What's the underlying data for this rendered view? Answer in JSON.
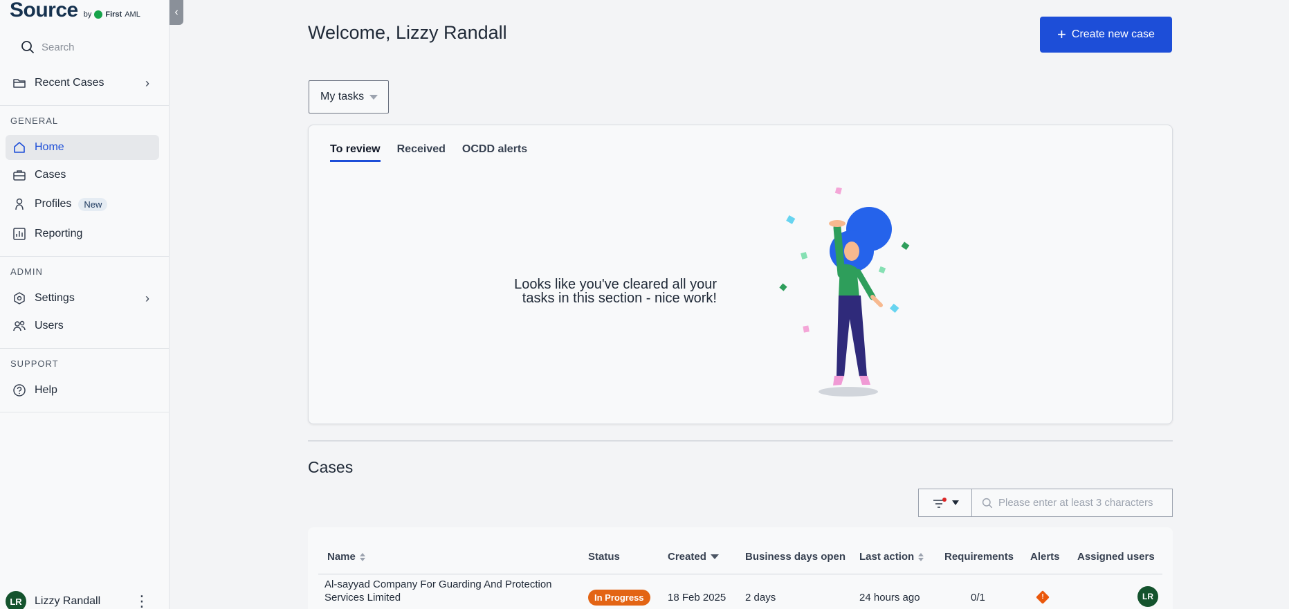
{
  "app": {
    "logo_text": "Source",
    "logo_by": "by",
    "logo_brand": "First",
    "logo_brand_suffix": "AML"
  },
  "search": {
    "placeholder": "Search"
  },
  "sidebar": {
    "recent_cases": "Recent Cases",
    "general_label": "GENERAL",
    "items": [
      {
        "label": "Home"
      },
      {
        "label": "Cases"
      },
      {
        "label": "Profiles",
        "badge": "New"
      },
      {
        "label": "Reporting"
      }
    ],
    "admin_label": "ADMIN",
    "admin_items": [
      {
        "label": "Settings"
      },
      {
        "label": "Users"
      }
    ],
    "support_label": "SUPPORT",
    "support_items": [
      {
        "label": "Help"
      }
    ],
    "user": {
      "initials": "LR",
      "name": "Lizzy Randall"
    }
  },
  "header": {
    "welcome": "Welcome, Lizzy Randall",
    "create_button": "Create new case"
  },
  "tasks": {
    "dropdown_label": "My tasks",
    "tabs": [
      {
        "label": "To review"
      },
      {
        "label": "Received"
      },
      {
        "label": "OCDD alerts"
      }
    ],
    "empty_line1": "Looks like you've cleared all your",
    "empty_line2": "tasks in this section - nice work!"
  },
  "cases": {
    "title": "Cases",
    "search_placeholder": "Please enter at least 3 characters",
    "columns": [
      "Name",
      "Status",
      "Created",
      "Business days open",
      "Last action",
      "Requirements",
      "Alerts",
      "Assigned users"
    ],
    "rows": [
      {
        "name_line1": "Al-sayyad Company For Guarding And Protection",
        "name_line2": "Services Limited",
        "status": "In Progress",
        "created": "18 Feb 2025",
        "days_open": "2 days",
        "last_action": "24 hours ago",
        "requirements": "0/1",
        "alert_icon": "!",
        "assigned_initials": "LR"
      }
    ]
  },
  "colors": {
    "accent": "#1d4ed8",
    "status_in_progress": "#e36414",
    "avatar": "#14532d"
  }
}
